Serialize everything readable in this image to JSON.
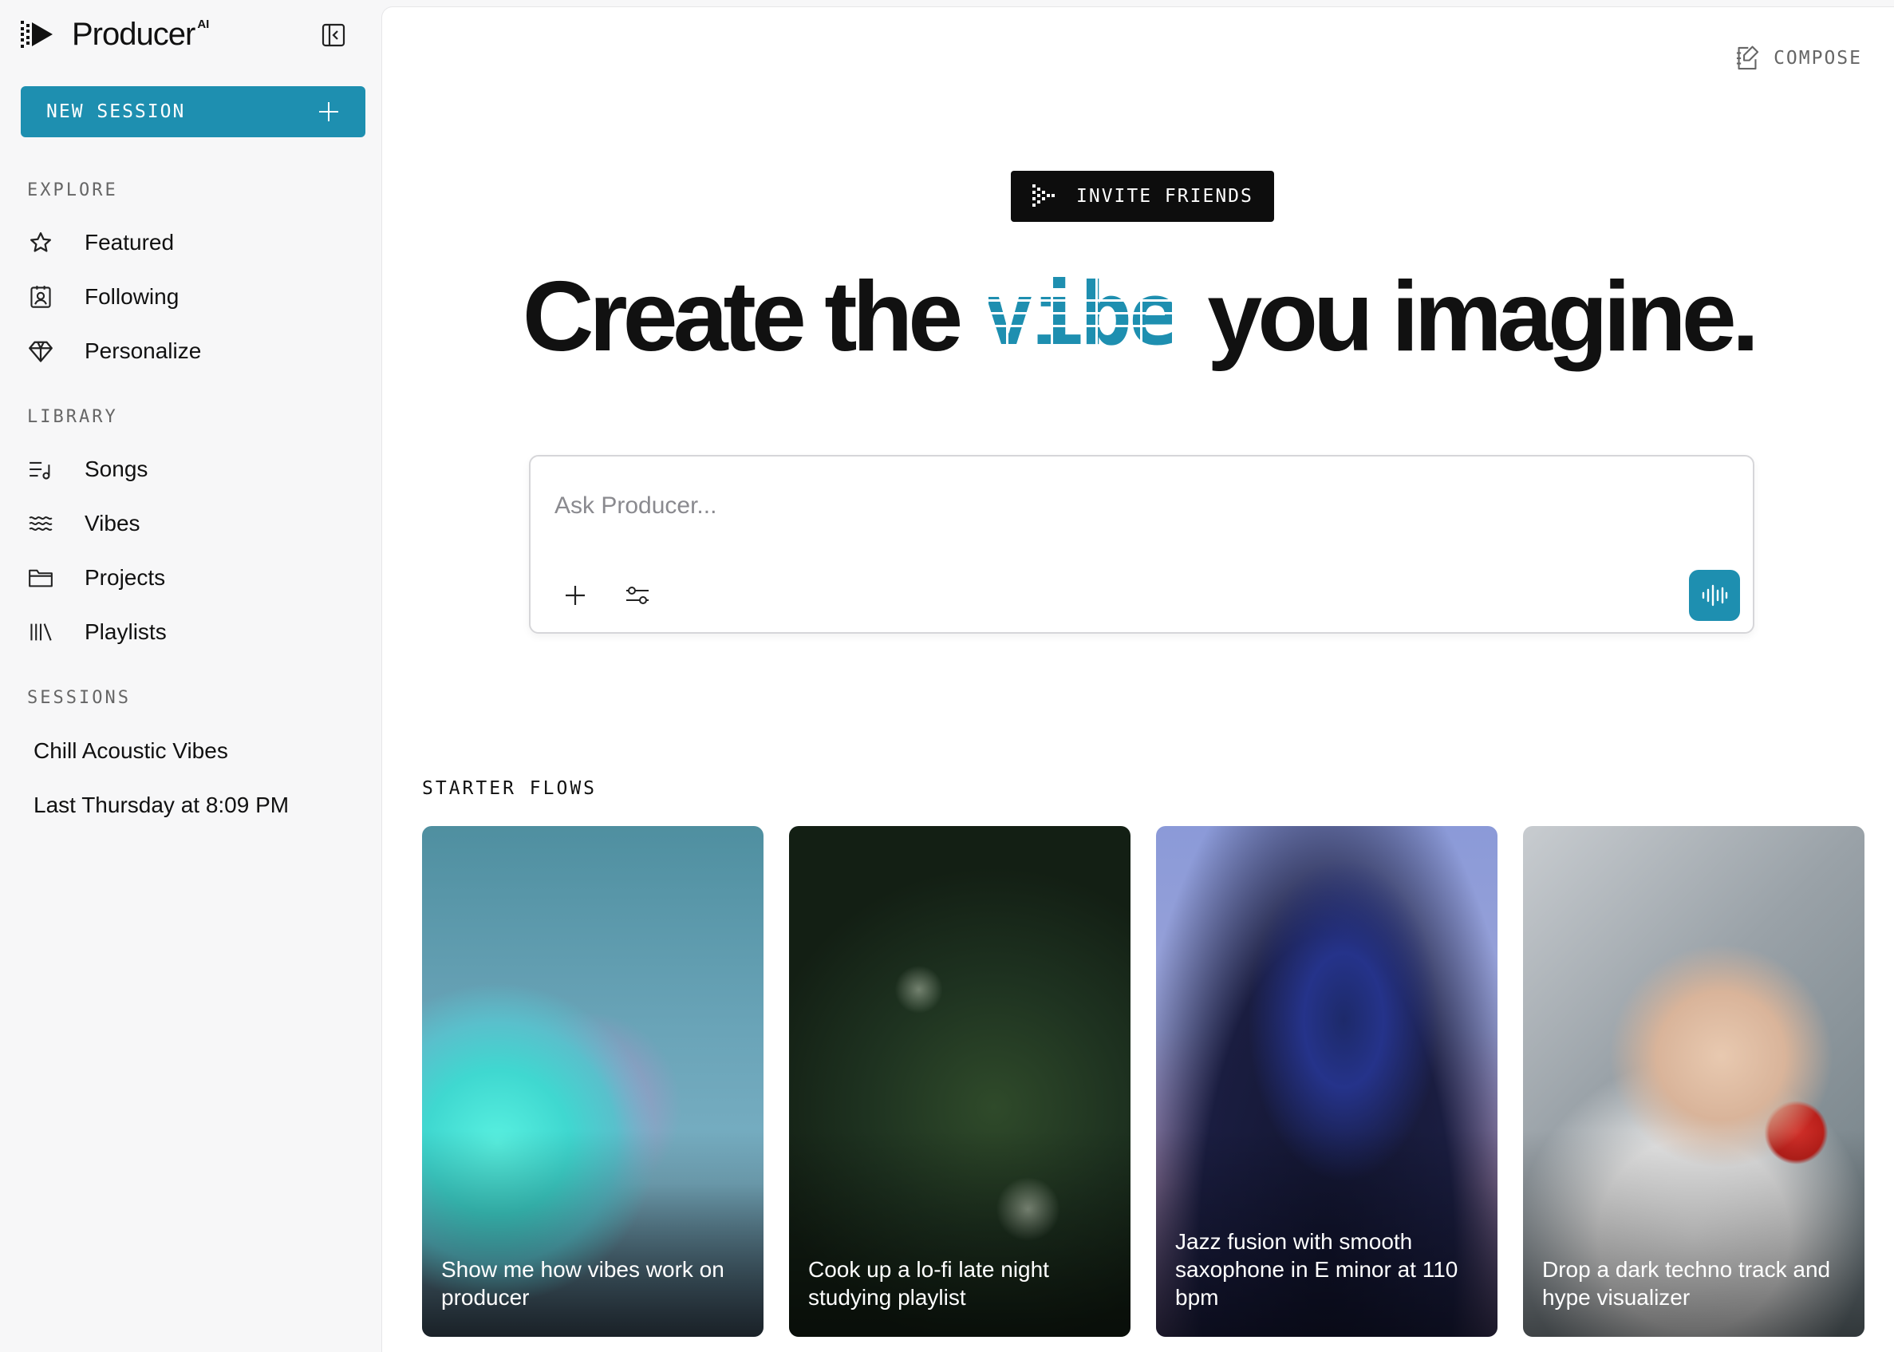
{
  "app": {
    "name": "Producer",
    "badge": "AI"
  },
  "sidebar": {
    "new_session_label": "NEW SESSION",
    "explore_label": "EXPLORE",
    "explore_items": [
      {
        "label": "Featured",
        "icon": "star-icon"
      },
      {
        "label": "Following",
        "icon": "contact-icon"
      },
      {
        "label": "Personalize",
        "icon": "diamond-icon"
      }
    ],
    "library_label": "LIBRARY",
    "library_items": [
      {
        "label": "Songs",
        "icon": "song-list-icon"
      },
      {
        "label": "Vibes",
        "icon": "waves-icon"
      },
      {
        "label": "Projects",
        "icon": "folder-icon"
      },
      {
        "label": "Playlists",
        "icon": "library-icon"
      }
    ],
    "sessions_label": "SESSIONS",
    "sessions": [
      {
        "label": "Chill Acoustic Vibes"
      },
      {
        "label": "Last Thursday at 8:09 PM"
      }
    ]
  },
  "header": {
    "compose_label": "COMPOSE"
  },
  "invite_label": "INVITE FRIENDS",
  "hero": {
    "before": "Create the",
    "highlight": "vibe",
    "after": "you imagine."
  },
  "ask": {
    "placeholder": "Ask Producer..."
  },
  "starter": {
    "label": "STARTER FLOWS",
    "cards": [
      {
        "caption": "Show me how vibes work on producer"
      },
      {
        "caption": "Cook up a lo-fi late night studying playlist"
      },
      {
        "caption": "Jazz fusion with smooth saxophone in E minor at 110 bpm"
      },
      {
        "caption": "Drop a dark techno track and hype visualizer"
      }
    ]
  },
  "colors": {
    "accent": "#1e8fb0",
    "dark": "#0d0d0d",
    "sidebar_bg": "#f7f7f8"
  }
}
